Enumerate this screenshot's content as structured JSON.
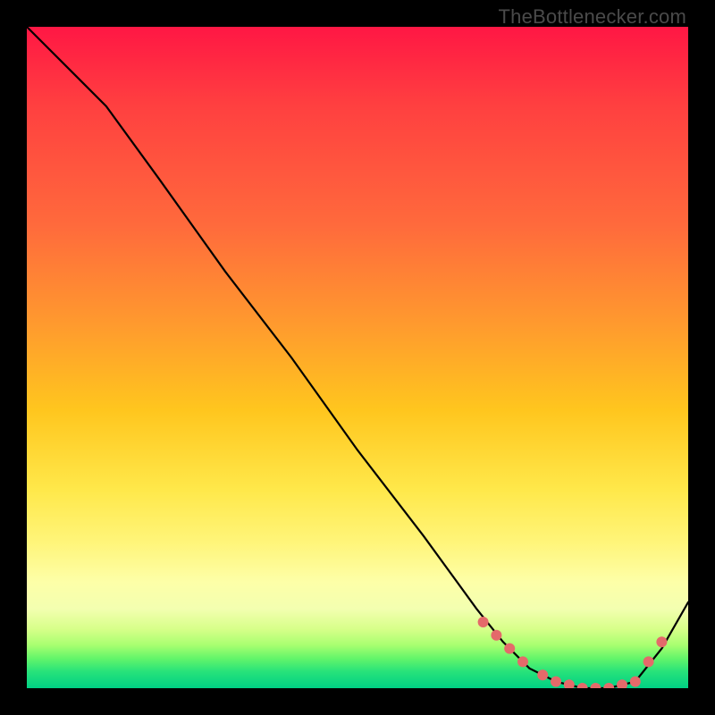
{
  "watermark": "TheBottlenecker.com",
  "colors": {
    "background": "#000000",
    "gradient_top": "#ff1744",
    "gradient_bottom": "#00d084",
    "curve": "#000000",
    "marker": "#e46a6a"
  },
  "chart_data": {
    "type": "line",
    "title": "",
    "xlabel": "",
    "ylabel": "",
    "xlim": [
      0,
      100
    ],
    "ylim": [
      0,
      100
    ],
    "series": [
      {
        "name": "bottleneck-curve",
        "x": [
          0,
          8,
          12,
          20,
          30,
          40,
          50,
          60,
          68,
          72,
          76,
          80,
          84,
          88,
          92,
          96,
          100
        ],
        "values": [
          100,
          92,
          88,
          77,
          63,
          50,
          36,
          23,
          12,
          7,
          3,
          1,
          0,
          0,
          1,
          6,
          13
        ]
      }
    ],
    "markers": {
      "name": "highlight-points",
      "x": [
        69,
        71,
        73,
        75,
        78,
        80,
        82,
        84,
        86,
        88,
        90,
        92,
        94,
        96
      ],
      "values": [
        10,
        8,
        6,
        4,
        2,
        1,
        0.5,
        0,
        0,
        0,
        0.5,
        1,
        4,
        7
      ]
    },
    "annotations": []
  }
}
